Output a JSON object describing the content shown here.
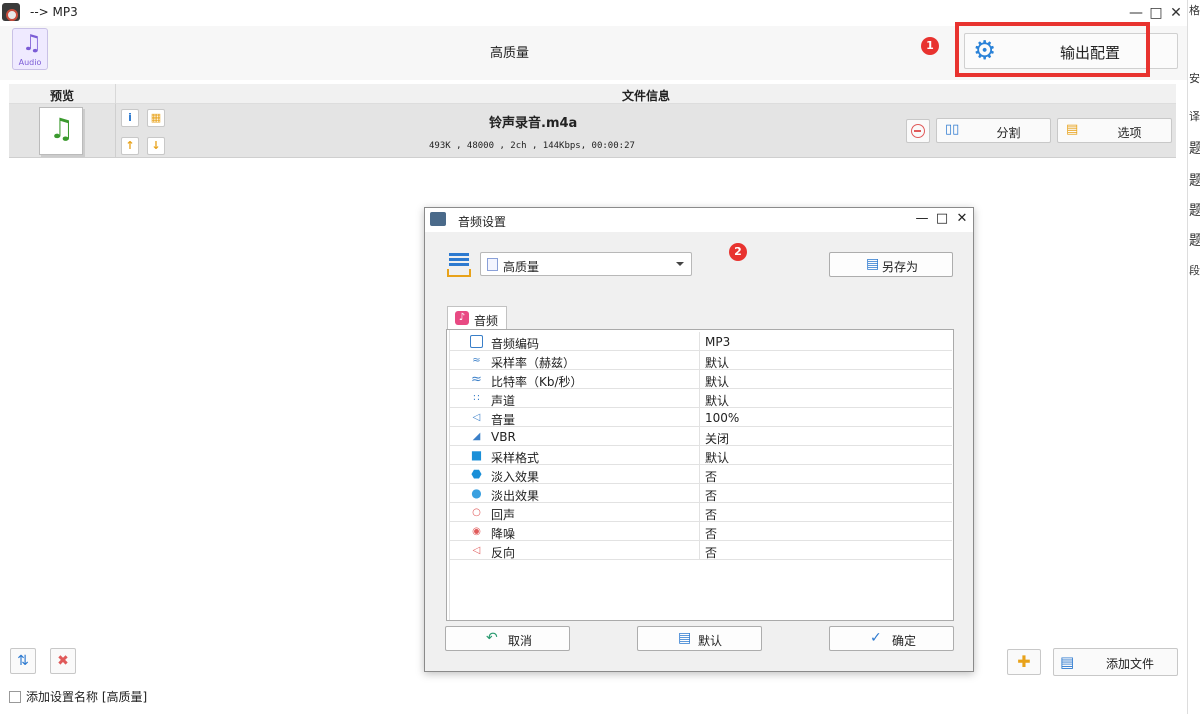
{
  "window": {
    "title": "--> MP3"
  },
  "header": {
    "audio_badge_label": "Audio",
    "preset_title": "高质量",
    "output_button_label": "输出配置",
    "badge1": "1"
  },
  "table": {
    "col_preview": "预览",
    "col_info": "文件信息"
  },
  "file": {
    "name": "铃声录音.m4a",
    "meta": "493K , 48000 , 2ch , 144Kbps, 00:00:27",
    "split_label": "分割",
    "options_label": "选项"
  },
  "bottom": {
    "add_file_label": "添加文件",
    "checkbox_label": "添加设置名称 [高质量]"
  },
  "side_strip": [
    "格:",
    "安",
    "译",
    "题",
    "题",
    "题",
    "题",
    "段"
  ],
  "dialog": {
    "title": "音频设置",
    "preset_value": "高质量",
    "save_as_label": "另存为",
    "badge2": "2",
    "tab_label": "音频",
    "rows": [
      {
        "icon": "settings-chip-icon",
        "key": "音频编码",
        "value": "MP3"
      },
      {
        "icon": "sample-rate-icon",
        "key": "采样率（赫兹）",
        "value": "默认"
      },
      {
        "icon": "bitrate-wave-icon",
        "key": "比特率（Kb/秒）",
        "value": "默认"
      },
      {
        "icon": "channel-icon",
        "key": "声道",
        "value": "默认"
      },
      {
        "icon": "volume-icon",
        "key": "音量",
        "value": "100%"
      },
      {
        "icon": "vbr-bars-icon",
        "key": "VBR",
        "value": "关闭"
      },
      {
        "icon": "cube-icon",
        "key": "采样格式",
        "value": "默认"
      },
      {
        "icon": "hexagon-icon",
        "key": "淡入效果",
        "value": "否"
      },
      {
        "icon": "circle-icon",
        "key": "淡出效果",
        "value": "否"
      },
      {
        "icon": "echo-icon",
        "key": "回声",
        "value": "否"
      },
      {
        "icon": "noise-icon",
        "key": "降噪",
        "value": "否"
      },
      {
        "icon": "reverse-icon",
        "key": "反向",
        "value": "否"
      }
    ],
    "cancel_label": "取消",
    "default_label": "默认",
    "ok_label": "确定"
  },
  "colors": {
    "accent": "#2d7ad0",
    "highlight": "#e8332f"
  }
}
